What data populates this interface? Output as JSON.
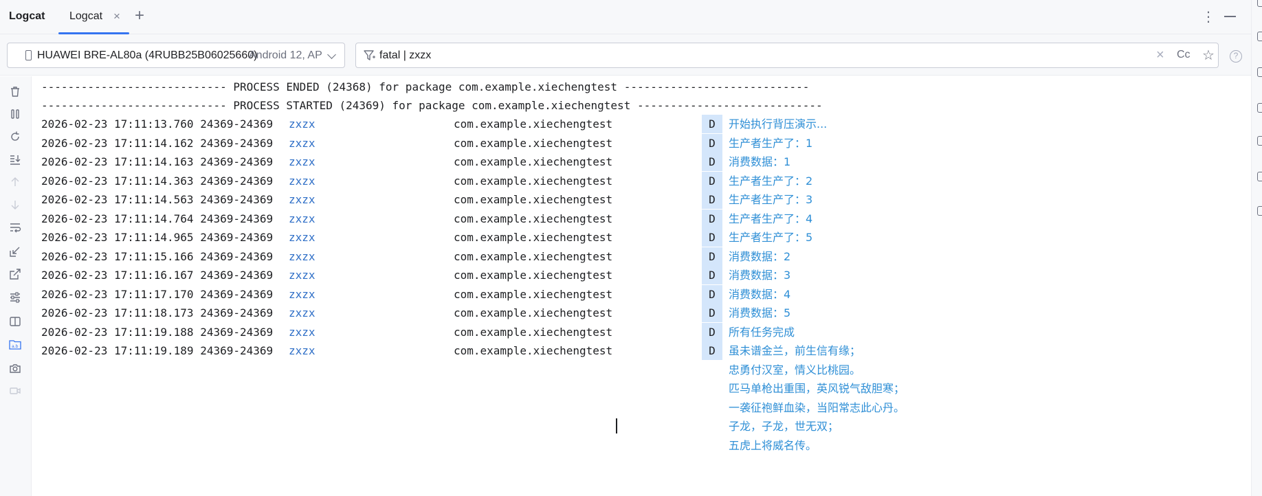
{
  "app": {
    "title": "Logcat"
  },
  "tabs": [
    {
      "label": "Logcat",
      "close": "×"
    }
  ],
  "tab_add": "+",
  "window": {
    "more": "⋮"
  },
  "device": {
    "name": "HUAWEI BRE-AL80a (4RUBB25B06025660)",
    "extra": "Android 12, AP"
  },
  "filter": {
    "value": "fatal | zxzx",
    "clear": "×",
    "case_label": "Cc",
    "favorite": "☆",
    "help": "?"
  },
  "log": {
    "process_lines": [
      "---------------------------- PROCESS ENDED (24368) for package com.example.xiechengtest ----------------------------",
      "---------------------------- PROCESS STARTED (24369) for package com.example.xiechengtest ----------------------------"
    ],
    "entries": [
      {
        "time": "2026-02-23 17:11:13.760 24369-24369",
        "tag": "zxzx",
        "package": "com.example.xiechengtest",
        "level": "D",
        "message": "开始执行背压演示..."
      },
      {
        "time": "2026-02-23 17:11:14.162 24369-24369",
        "tag": "zxzx",
        "package": "com.example.xiechengtest",
        "level": "D",
        "message": "生产者生产了：1"
      },
      {
        "time": "2026-02-23 17:11:14.163 24369-24369",
        "tag": "zxzx",
        "package": "com.example.xiechengtest",
        "level": "D",
        "message": "消费数据：1"
      },
      {
        "time": "2026-02-23 17:11:14.363 24369-24369",
        "tag": "zxzx",
        "package": "com.example.xiechengtest",
        "level": "D",
        "message": "生产者生产了：2"
      },
      {
        "time": "2026-02-23 17:11:14.563 24369-24369",
        "tag": "zxzx",
        "package": "com.example.xiechengtest",
        "level": "D",
        "message": "生产者生产了：3"
      },
      {
        "time": "2026-02-23 17:11:14.764 24369-24369",
        "tag": "zxzx",
        "package": "com.example.xiechengtest",
        "level": "D",
        "message": "生产者生产了：4"
      },
      {
        "time": "2026-02-23 17:11:14.965 24369-24369",
        "tag": "zxzx",
        "package": "com.example.xiechengtest",
        "level": "D",
        "message": "生产者生产了：5"
      },
      {
        "time": "2026-02-23 17:11:15.166 24369-24369",
        "tag": "zxzx",
        "package": "com.example.xiechengtest",
        "level": "D",
        "message": "消费数据：2"
      },
      {
        "time": "2026-02-23 17:11:16.167 24369-24369",
        "tag": "zxzx",
        "package": "com.example.xiechengtest",
        "level": "D",
        "message": "消费数据：3"
      },
      {
        "time": "2026-02-23 17:11:17.170 24369-24369",
        "tag": "zxzx",
        "package": "com.example.xiechengtest",
        "level": "D",
        "message": "消费数据：4"
      },
      {
        "time": "2026-02-23 17:11:18.173 24369-24369",
        "tag": "zxzx",
        "package": "com.example.xiechengtest",
        "level": "D",
        "message": "消费数据：5"
      },
      {
        "time": "2026-02-23 17:11:19.188 24369-24369",
        "tag": "zxzx",
        "package": "com.example.xiechengtest",
        "level": "D",
        "message": "所有任务完成"
      },
      {
        "time": "2026-02-23 17:11:19.189 24369-24369",
        "tag": "zxzx",
        "package": "com.example.xiechengtest",
        "level": "D",
        "message": "虽未谱金兰，前生信有缘；"
      }
    ],
    "continuation": [
      "忠勇付汉室，情义比桃园。",
      "匹马单枪出重围，英风锐气敌胆寒；",
      "一袭征袍鲜血染，当阳常志此心丹。",
      "子龙，子龙，世无双；",
      "五虎上将威名传。"
    ]
  },
  "colors": {
    "accent": "#3574f0",
    "tag": "#2f6fc7",
    "message": "#2f8fd6",
    "level_bg": "#d4e6fb"
  },
  "toolbar_icons": [
    "trash-icon",
    "pause-icon",
    "restart-icon",
    "scroll-to-end-icon",
    "up-icon",
    "down-icon",
    "soft-wrap-icon",
    "import-icon",
    "export-icon",
    "settings-icon",
    "split-icon",
    "folder-ab-icon",
    "camera-icon",
    "video-icon"
  ]
}
